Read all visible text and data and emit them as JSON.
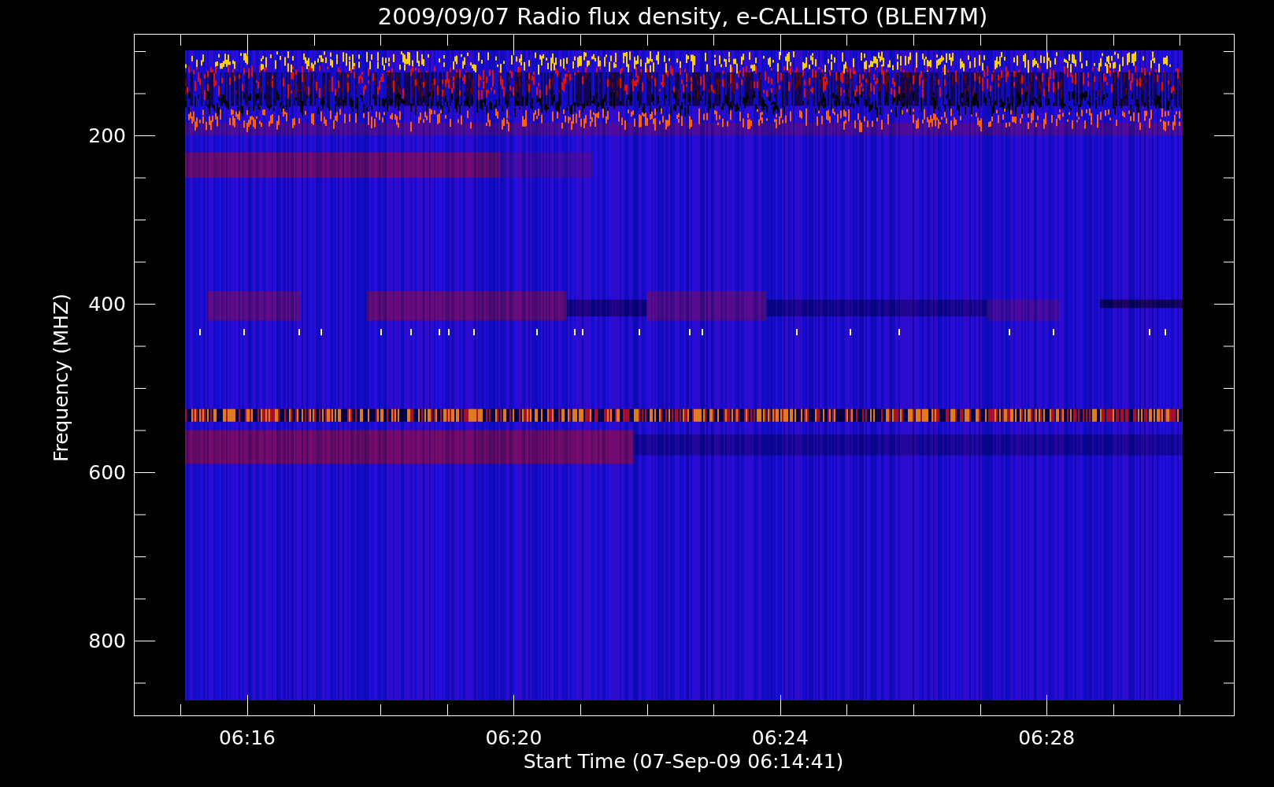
{
  "title": "2009/09/07  Radio flux density, e-CALLISTO (BLEN7M)",
  "y_axis": {
    "label": "Frequency (MHZ)",
    "tick_labels": [
      "200",
      "400",
      "600",
      "800"
    ]
  },
  "x_axis": {
    "label": "Start Time (07-Sep-09 06:14:41)",
    "tick_labels": [
      "06:16",
      "06:20",
      "06:24",
      "06:28"
    ]
  }
}
